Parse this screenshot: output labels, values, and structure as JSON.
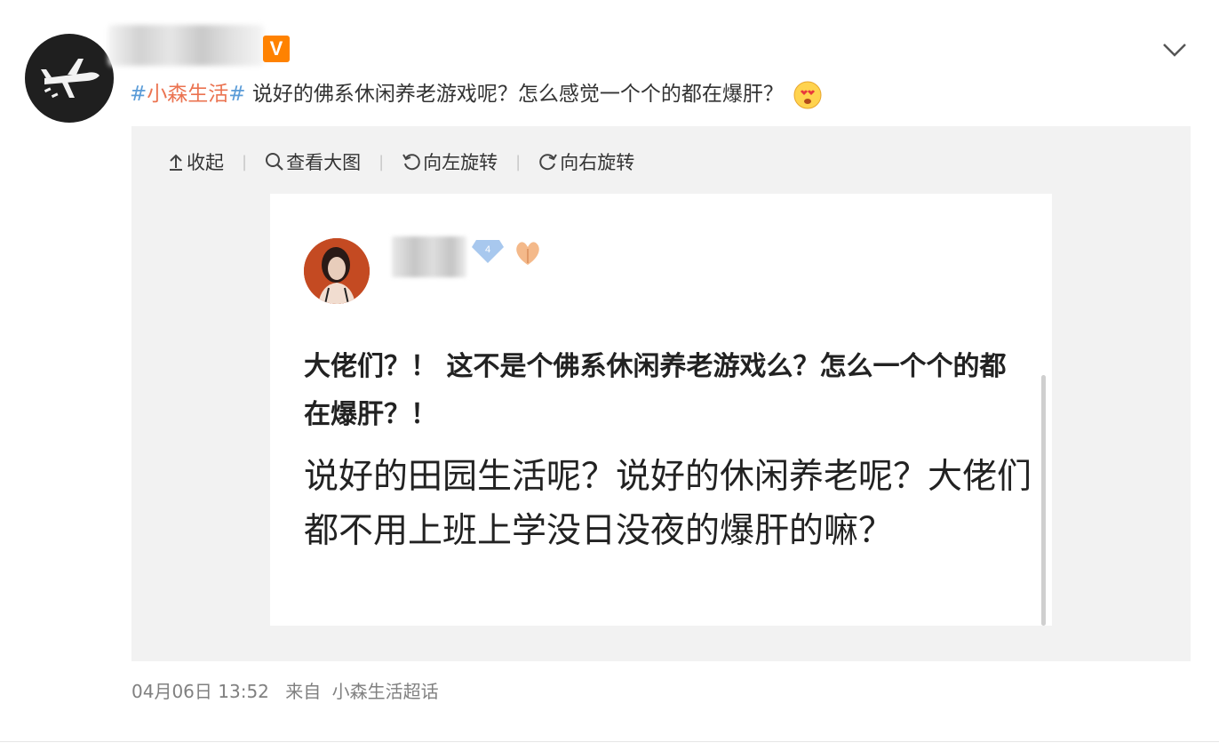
{
  "post": {
    "topic_hash_open": "#",
    "topic": "小森生活",
    "topic_hash_close": "#",
    "text": " 说好的佛系休闲养老游戏呢？怎么感觉一个个的都在爆肝？",
    "verified_badge": "V",
    "emoji": "face-with-heart-eyes"
  },
  "toolbar": {
    "collapse": "收起",
    "view_large": "查看大图",
    "rotate_left": "向左旋转",
    "rotate_right": "向右旋转"
  },
  "screenshot": {
    "level": "4",
    "bold_text": "大佬们？！ 这不是个佛系休闲养老游戏么？怎么一个个的都在爆肝？！",
    "big_text": "说好的田园生活呢？说好的休闲养老呢？大佬们都不用上班上学没日没夜的爆肝的嘛？"
  },
  "footer": {
    "time": "04月06日 13:52",
    "from_label": "来自",
    "source": "小森生活超话"
  },
  "colors": {
    "topic": "#eb7350",
    "hash": "#5b9cd8",
    "verified": "#ff8200",
    "media_bg": "#f2f2f2",
    "footer_text": "#808080"
  }
}
